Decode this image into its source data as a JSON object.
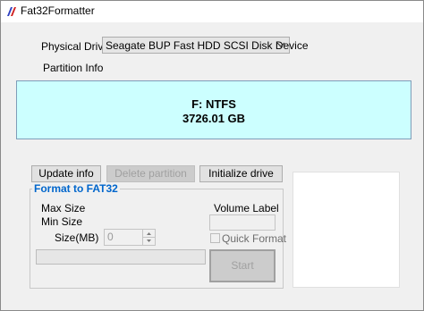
{
  "window": {
    "title": "Fat32Formatter"
  },
  "drive": {
    "label": "Physical Drive",
    "selected": "Seagate BUP Fast HDD SCSI Disk Device"
  },
  "partition": {
    "label": "Partition Info",
    "line1": "F: NTFS",
    "line2": "3726.01 GB",
    "bg_color": "#ccffff"
  },
  "buttons": {
    "update": "Update info",
    "delete": "Delete partition",
    "initialize": "Initialize drive"
  },
  "format": {
    "title": "Format to FAT32",
    "max_size": "Max Size",
    "min_size": "Min Size",
    "size_label": "Size(MB)",
    "size_value": "0",
    "volume_label": "Volume Label",
    "volume_value": "",
    "quick_format": "Quick Format",
    "start": "Start",
    "title_color": "#0066cc"
  }
}
